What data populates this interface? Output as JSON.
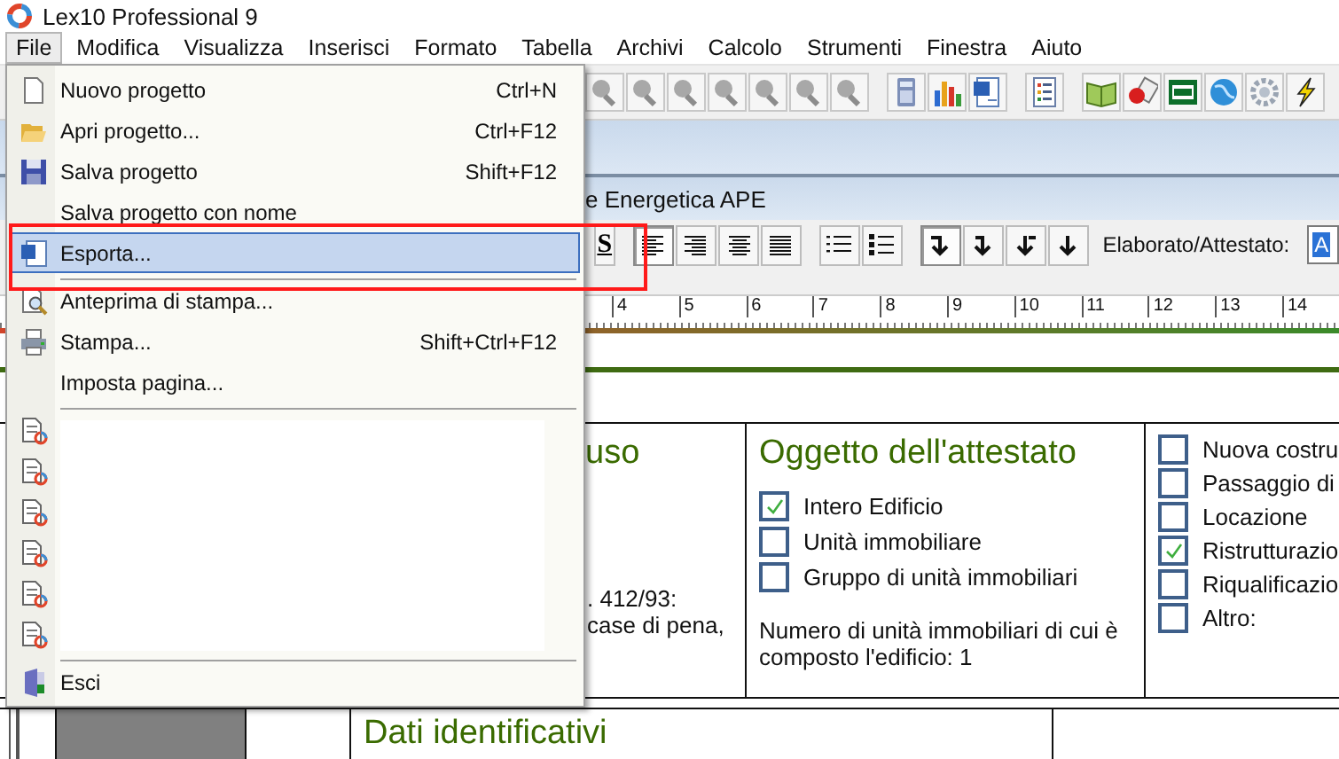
{
  "window": {
    "title": "Lex10 Professional 9"
  },
  "menu_bar": [
    {
      "label": "File",
      "selected": true
    },
    {
      "label": "Modifica",
      "selected": false
    },
    {
      "label": "Visualizza",
      "selected": false
    },
    {
      "label": "Inserisci",
      "selected": false
    },
    {
      "label": "Formato",
      "selected": false
    },
    {
      "label": "Tabella",
      "selected": false
    },
    {
      "label": "Archivi",
      "selected": false
    },
    {
      "label": "Calcolo",
      "selected": false
    },
    {
      "label": "Strumenti",
      "selected": false
    },
    {
      "label": "Finestra",
      "selected": false
    },
    {
      "label": "Aiuto",
      "selected": false
    }
  ],
  "file_menu": [
    {
      "kind": "item",
      "label": "Nuovo progetto",
      "shortcut": "Ctrl+N",
      "selected": false
    },
    {
      "kind": "item",
      "label": "Apri progetto...",
      "shortcut": "Ctrl+F12",
      "selected": false
    },
    {
      "kind": "item",
      "label": "Salva progetto",
      "shortcut": "Shift+F12",
      "selected": false
    },
    {
      "kind": "item",
      "label": "Salva progetto con nome",
      "selected": false
    },
    {
      "kind": "item",
      "label": "Esporta...",
      "selected": true
    },
    {
      "kind": "separator"
    },
    {
      "kind": "item",
      "label": "Anteprima di stampa...",
      "selected": false
    },
    {
      "kind": "item",
      "label": "Stampa...",
      "shortcut": "Shift+Ctrl+F12",
      "selected": false
    },
    {
      "kind": "item",
      "label": "Imposta pagina...",
      "selected": false
    },
    {
      "kind": "separator"
    },
    {
      "kind": "recent"
    },
    {
      "kind": "recent"
    },
    {
      "kind": "recent"
    },
    {
      "kind": "recent"
    },
    {
      "kind": "recent"
    },
    {
      "kind": "recent"
    },
    {
      "kind": "separator"
    },
    {
      "kind": "item",
      "label": "Esci",
      "selected": false
    }
  ],
  "document_window": {
    "title": "e Energetica APE"
  },
  "format_toolbar": {
    "bold_button": "S",
    "align_buttons": [
      {
        "selected": true
      },
      {
        "selected": false
      },
      {
        "selected": false
      },
      {
        "selected": false
      }
    ],
    "indent_buttons": [
      {
        "selected": true
      },
      {
        "selected": false
      },
      {
        "selected": false
      },
      {
        "selected": false
      }
    ],
    "field_label": "Elaborato/Attestato:",
    "field_value": "A"
  },
  "ruler": {
    "numbers": [
      "4",
      "5",
      "6",
      "7",
      "8",
      "9",
      "10",
      "11",
      "12",
      "13",
      "14"
    ]
  },
  "document": {
    "use_cell": {
      "heading": "uso",
      "lines": [
        ". 412/93:",
        "case di pena,"
      ]
    },
    "object_cell": {
      "heading": "Oggetto dell'attestato",
      "options": [
        {
          "label": "Intero Edificio",
          "checked": true
        },
        {
          "label": "Unità immobiliare",
          "checked": false
        },
        {
          "label": "Gruppo di unità immobiliari",
          "checked": false
        }
      ],
      "note": "Numero di unità immobiliari di cui è composto l'edificio: 1"
    },
    "reason_cell": {
      "options": [
        {
          "label": "Nuova costru",
          "checked": false
        },
        {
          "label": "Passaggio di",
          "checked": false
        },
        {
          "label": "Locazione",
          "checked": false
        },
        {
          "label": "Ristrutturazio",
          "checked": true
        },
        {
          "label": "Riqualificazio",
          "checked": false
        },
        {
          "label": "Altro:",
          "checked": false
        }
      ]
    },
    "section_heading": "Dati identificativi"
  }
}
